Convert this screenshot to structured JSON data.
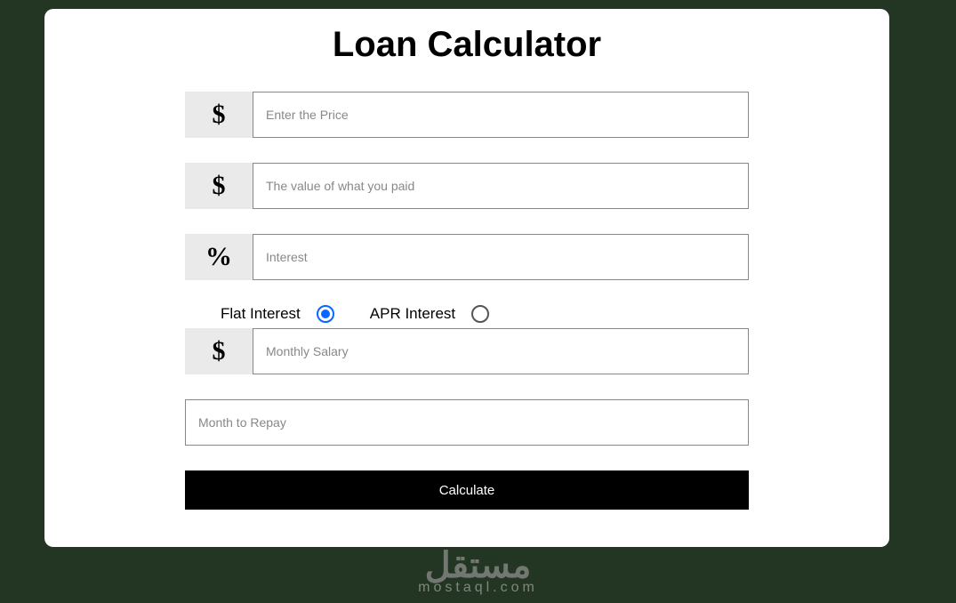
{
  "title": "Loan Calculator",
  "fields": {
    "price": {
      "prefix": "$",
      "placeholder": "Enter the Price",
      "value": ""
    },
    "paid": {
      "prefix": "$",
      "placeholder": "The value of what you paid",
      "value": ""
    },
    "interest": {
      "prefix": "%",
      "placeholder": "Interest",
      "value": ""
    },
    "salary": {
      "prefix": "$",
      "placeholder": "Monthly Salary",
      "value": ""
    },
    "repay": {
      "placeholder": "Month to Repay",
      "value": ""
    }
  },
  "interest_options": {
    "flat": {
      "label": "Flat Interest",
      "selected": true
    },
    "apr": {
      "label": "APR Interest",
      "selected": false
    }
  },
  "button": {
    "calculate": "Calculate"
  },
  "watermark": {
    "logo": "مستقل",
    "text": "mostaql.com"
  }
}
